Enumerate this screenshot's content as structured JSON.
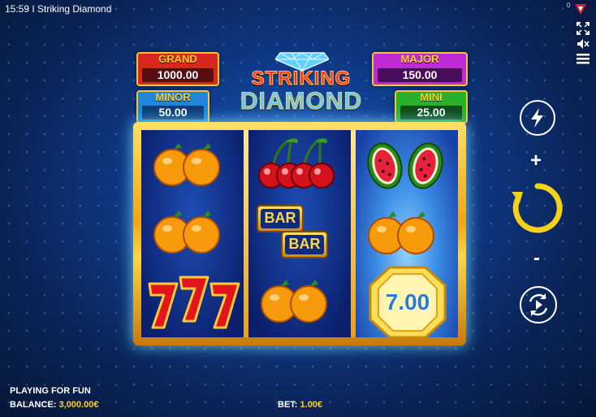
{
  "window": {
    "title": "15:59 I Striking Diamond",
    "corner_count": "0"
  },
  "game": {
    "logo": {
      "line1": "STRIKING",
      "line2": "DIAMOND"
    },
    "jackpots": {
      "grand": {
        "label": "GRAND",
        "value": "1000.00"
      },
      "minor": {
        "label": "MINOR",
        "value": "50.00"
      },
      "major": {
        "label": "MAJOR",
        "value": "150.00"
      },
      "mini": {
        "label": "MINI",
        "value": "25.00"
      }
    },
    "reels": [
      [
        "orange",
        "orange",
        "seven"
      ],
      [
        "cherry",
        "bar-bar",
        "orange"
      ],
      [
        "watermelon",
        "orange",
        "coin"
      ]
    ],
    "bar_text": "BAR",
    "coin_value": "7.00"
  },
  "controls": {
    "plus": "+",
    "minus": "-"
  },
  "status": {
    "mode": "PLAYING FOR FUN",
    "balance_label": "BALANCE:",
    "balance_value": "3,000.00€",
    "bet_label": "BET:",
    "bet_value": "1.00€"
  },
  "colors": {
    "accent": "#f7c531",
    "spin_ring": "#f5d21a",
    "background": "#0f3c8c"
  }
}
